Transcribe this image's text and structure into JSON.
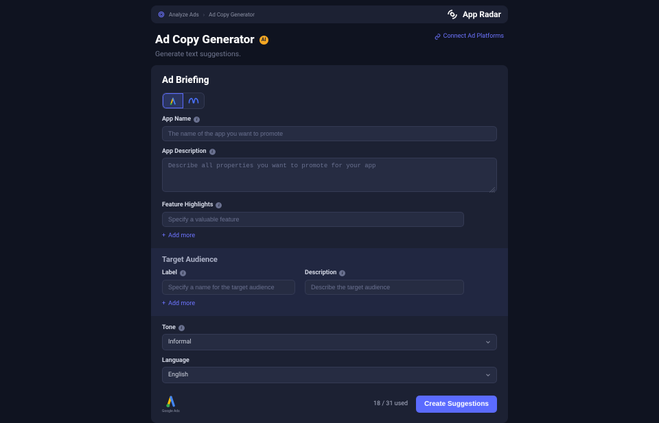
{
  "breadcrumbs": {
    "root": "Analyze Ads",
    "current": "Ad Copy Generator"
  },
  "brand": {
    "name": "App Radar"
  },
  "header": {
    "title": "Ad Copy Generator",
    "ai_badge": "AI",
    "subtitle": "Generate text suggestions.",
    "connect_label": "Connect Ad Platforms"
  },
  "briefing": {
    "title": "Ad Briefing",
    "platforms": {
      "google_selected": true,
      "meta_selected": false
    },
    "app_name": {
      "label": "App Name",
      "placeholder": "The name of the app you want to promote",
      "value": ""
    },
    "app_description": {
      "label": "App Description",
      "placeholder": "Describe all properties you want to promote for your app",
      "value": ""
    },
    "features": {
      "label": "Feature Highlights",
      "placeholder": "Specify a valuable feature",
      "value": "",
      "add_more": "Add more"
    },
    "audience": {
      "title": "Target Audience",
      "label_label": "Label",
      "label_placeholder": "Specify a name for the target audience",
      "label_value": "",
      "desc_label": "Description",
      "desc_placeholder": "Describe the target audience",
      "desc_value": "",
      "add_more": "Add more"
    },
    "tone": {
      "label": "Tone",
      "value": "Informal"
    },
    "language": {
      "label": "Language",
      "value": "English"
    }
  },
  "footer": {
    "usage": "18 / 31 used",
    "cta": "Create Suggestions",
    "provider": "Google Ads"
  }
}
